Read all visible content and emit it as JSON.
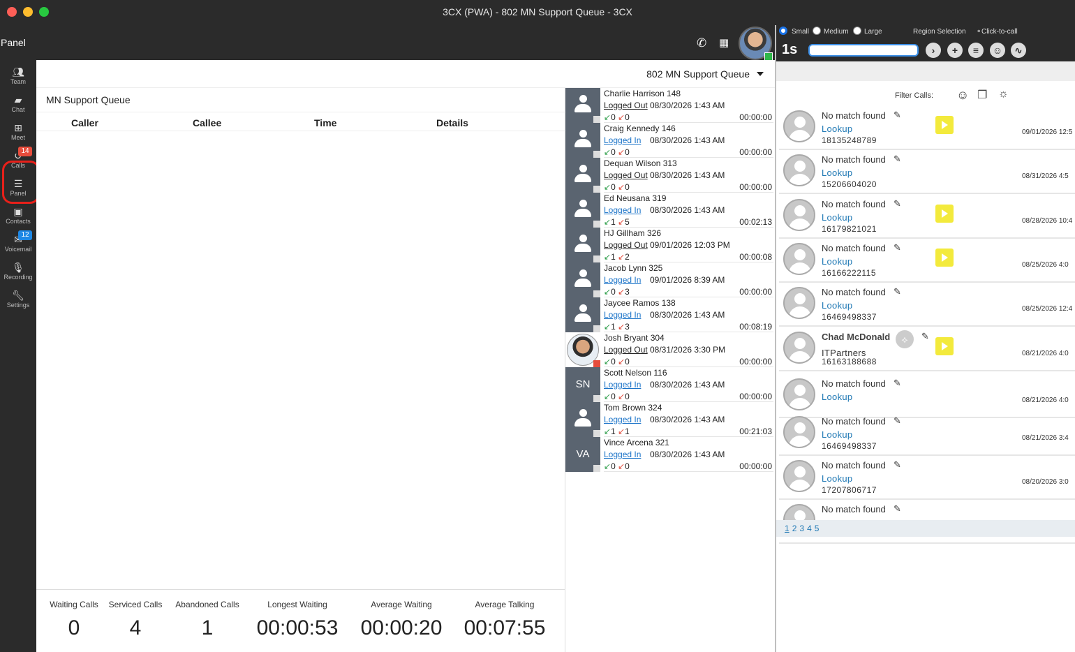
{
  "window": {
    "title": "3CX (PWA) - 802 MN Support Queue - 3CX"
  },
  "header": {
    "panel_title": "Panel"
  },
  "nav": [
    {
      "label": "Team",
      "icon": "team-icon"
    },
    {
      "label": "Chat",
      "icon": "chat-icon"
    },
    {
      "label": "Meet",
      "icon": "meet-icon"
    },
    {
      "label": "Calls",
      "icon": "calls-icon",
      "badge": "14"
    },
    {
      "label": "Panel",
      "icon": "panel-icon"
    },
    {
      "label": "Contacts",
      "icon": "contacts-icon"
    },
    {
      "label": "Voicemail",
      "icon": "voicemail-icon",
      "badge": "12"
    },
    {
      "label": "Recording",
      "icon": "recording-icon"
    },
    {
      "label": "Settings",
      "icon": "settings-icon"
    }
  ],
  "queue_selector": "802 MN Support Queue",
  "queue": {
    "title": "MN Support Queue",
    "columns": [
      "Caller",
      "Callee",
      "Time",
      "Details"
    ],
    "stats": [
      {
        "label": "Waiting Calls",
        "value": "0"
      },
      {
        "label": "Serviced Calls",
        "value": "4"
      },
      {
        "label": "Abandoned Calls",
        "value": "1"
      },
      {
        "label": "Longest Waiting",
        "value": "00:00:53"
      },
      {
        "label": "Average Waiting",
        "value": "00:00:20"
      },
      {
        "label": "Average Talking",
        "value": "00:07:55"
      }
    ]
  },
  "agents": [
    {
      "name": "Charlie Harrison 148",
      "state": "Logged Out",
      "date": "08/30/2026 1:43 AM",
      "in": "0",
      "out": "0",
      "time": "00:00:00",
      "avatar": ""
    },
    {
      "name": "Craig Kennedy 146",
      "state": "Logged In",
      "date": "08/30/2026 1:43 AM",
      "in": "0",
      "out": "0",
      "time": "00:00:00",
      "avatar": ""
    },
    {
      "name": "Dequan Wilson 313",
      "state": "Logged Out",
      "date": "08/30/2026 1:43 AM",
      "in": "0",
      "out": "0",
      "time": "00:00:00",
      "avatar": ""
    },
    {
      "name": "Ed Neusana 319",
      "state": "Logged In",
      "date": "08/30/2026 1:43 AM",
      "in": "1",
      "out": "5",
      "time": "00:02:13",
      "avatar": ""
    },
    {
      "name": "HJ Gillham 326",
      "state": "Logged Out",
      "date": "09/01/2026 12:03 PM",
      "in": "1",
      "out": "2",
      "time": "00:00:08",
      "avatar": ""
    },
    {
      "name": "Jacob Lynn 325",
      "state": "Logged In",
      "date": "09/01/2026 8:39 AM",
      "in": "0",
      "out": "3",
      "time": "00:00:00",
      "avatar": ""
    },
    {
      "name": "Jaycee Ramos 138",
      "state": "Logged In",
      "date": "08/30/2026 1:43 AM",
      "in": "1",
      "out": "3",
      "time": "00:08:19",
      "avatar": ""
    },
    {
      "name": "Josh Bryant 304",
      "state": "Logged Out",
      "date": "08/31/2026 3:30 PM",
      "in": "0",
      "out": "0",
      "time": "00:00:00",
      "avatar": "photo"
    },
    {
      "name": "Scott Nelson 116",
      "state": "Logged In",
      "date": "08/30/2026 1:43 AM",
      "in": "0",
      "out": "0",
      "time": "00:00:00",
      "avatar": "SN"
    },
    {
      "name": "Tom Brown 324",
      "state": "Logged In",
      "date": "08/30/2026 1:43 AM",
      "in": "1",
      "out": "1",
      "time": "00:21:03",
      "avatar": ""
    },
    {
      "name": "Vince Arcena 321",
      "state": "Logged In",
      "date": "08/30/2026 1:43 AM",
      "in": "0",
      "out": "0",
      "time": "00:00:00",
      "avatar": "VA"
    }
  ],
  "crm": {
    "sizes": [
      "Small",
      "Medium",
      "Large"
    ],
    "region_selection": "Region Selection",
    "click_to_call": "Click-to-call",
    "logo": "1s",
    "filter_label": "Filter Calls:",
    "calls": [
      {
        "name": "No match found",
        "link": "Lookup",
        "number": "18135248789",
        "date": "09/01/2026 12:5",
        "play": true
      },
      {
        "name": "No match found",
        "link": "Lookup",
        "number": "15206604020",
        "date": "08/31/2026 4:5",
        "play": false
      },
      {
        "name": "No match found",
        "link": "Lookup",
        "number": "16179821021",
        "date": "08/28/2026 10:4",
        "play": true
      },
      {
        "name": "No match found",
        "link": "Lookup",
        "number": "16166222115",
        "date": "08/25/2026 4:0",
        "play": true
      },
      {
        "name": "No match found",
        "link": "Lookup",
        "number": "16469498337",
        "date": "08/25/2026 12:4",
        "play": false
      },
      {
        "name": "Chad McDonald",
        "org": "ITPartners",
        "number": "16163188688",
        "date": "08/21/2026 4:0",
        "play": true
      },
      {
        "name": "No match found",
        "link": "Lookup",
        "number": "",
        "date": "08/21/2026 4:0",
        "play": false
      },
      {
        "name": "No match found",
        "link": "Lookup",
        "number": "16469498337",
        "date": "08/21/2026 3:4",
        "play": false
      },
      {
        "name": "No match found",
        "link": "Lookup",
        "number": "17207806717",
        "date": "08/20/2026 3:0",
        "play": false
      },
      {
        "name": "No match found",
        "link": "",
        "number": "",
        "date": "",
        "play": false
      }
    ],
    "pages": [
      "1",
      "2",
      "3",
      "4",
      "5"
    ]
  },
  "colors": {
    "chrome": "#2b2b2b",
    "link": "#1a73c8",
    "play": "#f3ea3c",
    "badge_red": "#e74c3c",
    "badge_blue": "#1e88e5",
    "highlight_ring": "#e8201a"
  }
}
